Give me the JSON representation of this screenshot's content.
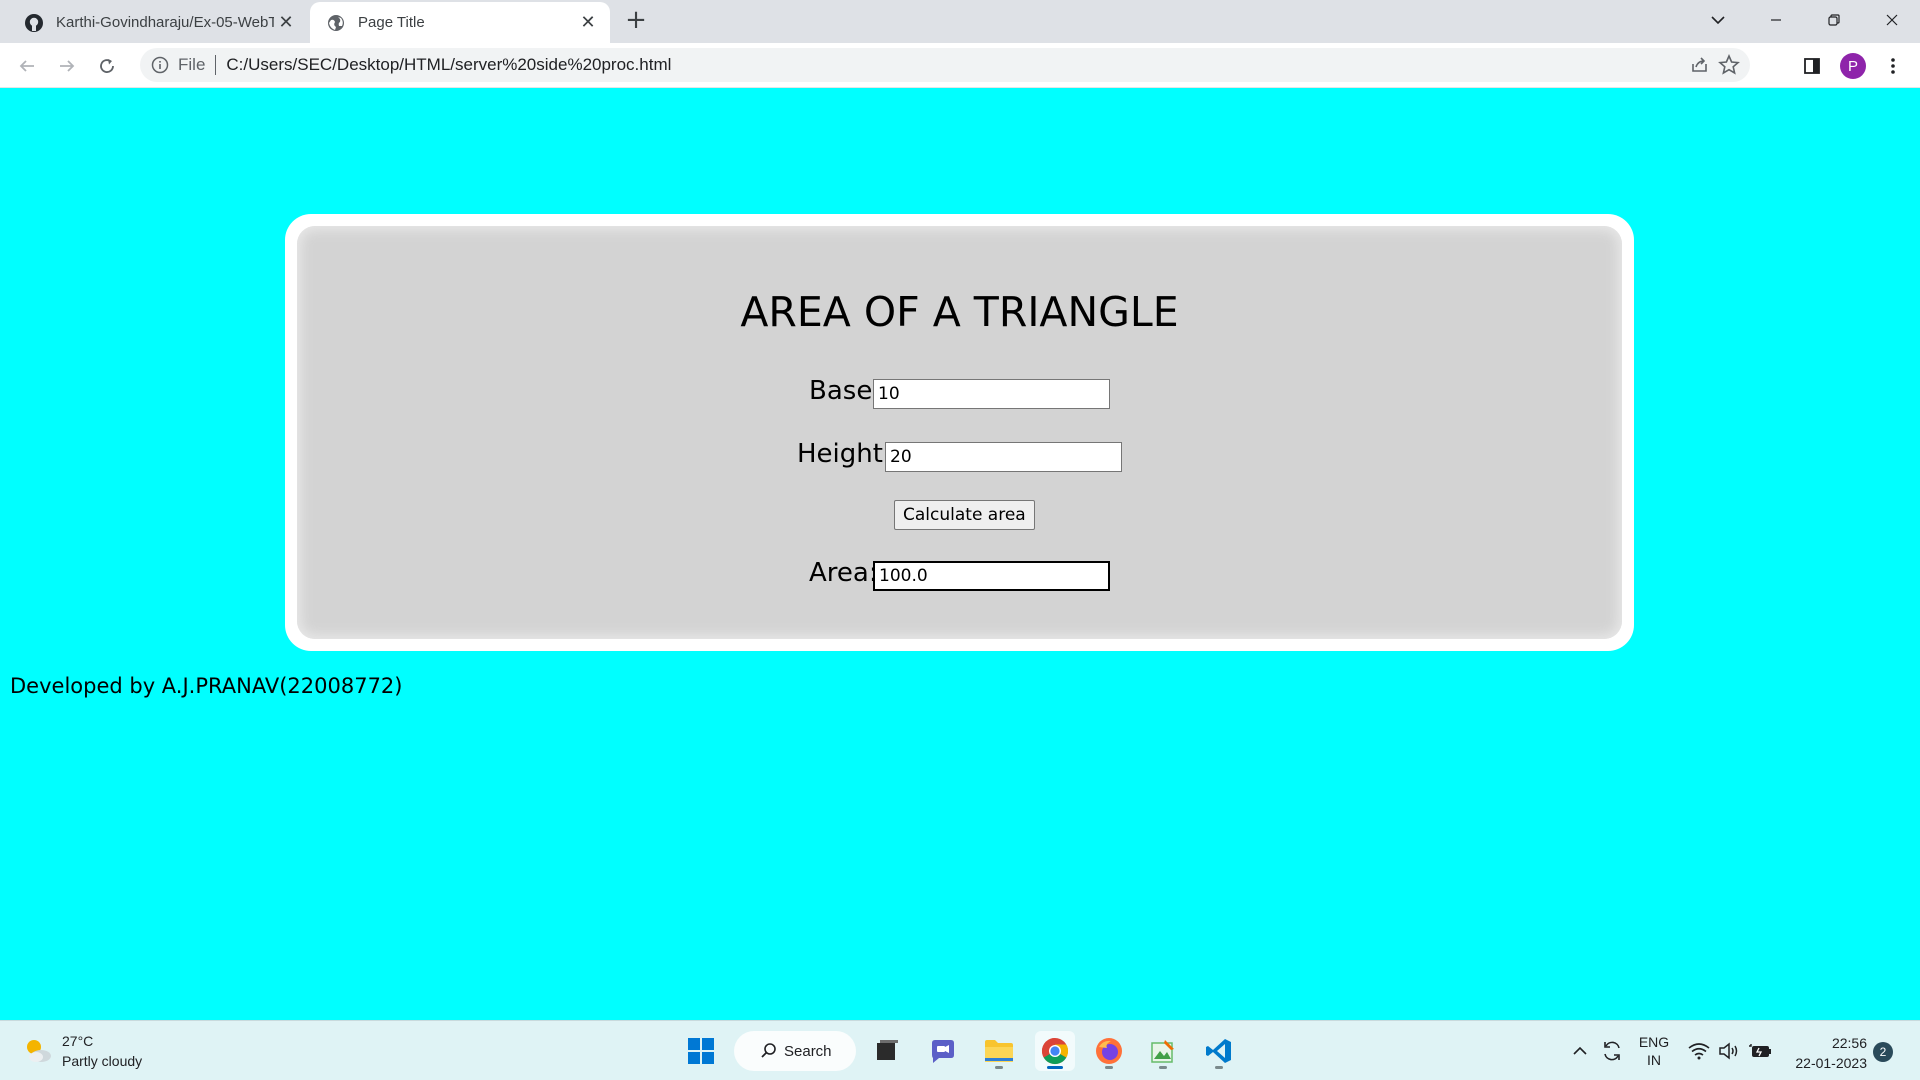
{
  "browser": {
    "tabs": [
      {
        "title": "Karthi-Govindharaju/Ex-05-WebT",
        "icon": "github-icon",
        "active": false
      },
      {
        "title": "Page Title",
        "icon": "globe-icon",
        "active": true
      }
    ],
    "address": {
      "scheme_label": "File",
      "url": "C:/Users/SEC/Desktop/HTML/server%20side%20proc.html"
    },
    "profile_initial": "P"
  },
  "page": {
    "heading": "AREA OF A TRIANGLE",
    "base": {
      "label": "Base:",
      "value": "10"
    },
    "height": {
      "label": "Height:",
      "value": "20"
    },
    "calculate_button": "Calculate area",
    "area": {
      "label": "Area:",
      "value": "100.0"
    },
    "footer": "Developed by A.J.PRANAV(22008772)",
    "background_color": "#00ffff"
  },
  "taskbar": {
    "weather": {
      "temperature": "27°C",
      "condition": "Partly cloudy"
    },
    "search_label": "Search",
    "language": {
      "line1": "ENG",
      "line2": "IN"
    },
    "clock": {
      "time": "22:56",
      "date": "22-01-2023"
    },
    "notification_count": "2"
  }
}
